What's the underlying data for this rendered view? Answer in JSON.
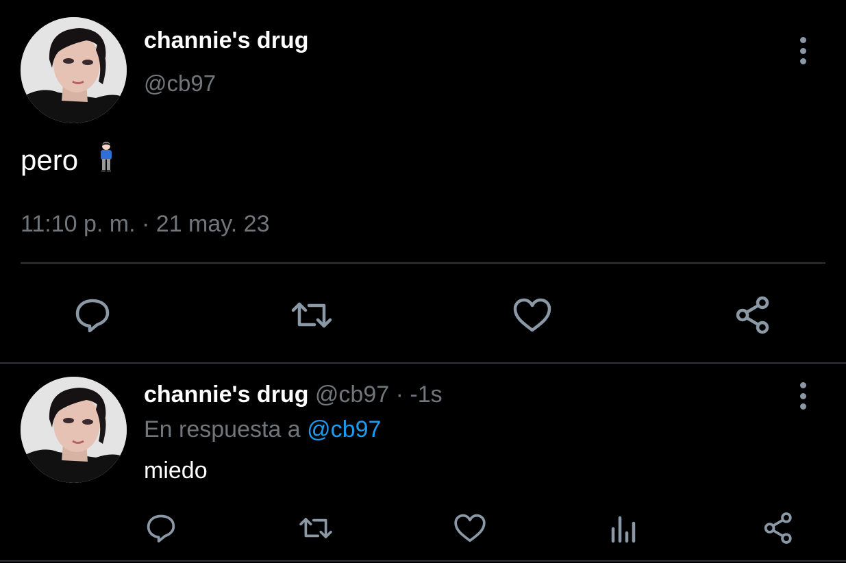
{
  "main_tweet": {
    "display_name": "channie's drug",
    "handle": "@cb97",
    "text": "pero",
    "emoji": "🧍🏻‍♂️",
    "timestamp": "11:10 p. m. · 21 may. 23",
    "actions": [
      "reply-icon",
      "retweet-icon",
      "like-icon",
      "share-icon"
    ]
  },
  "reply_tweet": {
    "display_name": "channie's drug",
    "meta": "@cb97 · -1s",
    "reply_prefix": "En respuesta a",
    "reply_mention": "@cb97",
    "text": "miedo",
    "actions": [
      "reply-icon",
      "retweet-icon",
      "like-icon",
      "views-icon",
      "share-icon"
    ]
  },
  "colors": {
    "background": "#000000",
    "primary_text": "#ffffff",
    "secondary_text": "#71767b",
    "icon": "#8b98a5",
    "link": "#1d9bf0",
    "divider": "#2f3336"
  }
}
